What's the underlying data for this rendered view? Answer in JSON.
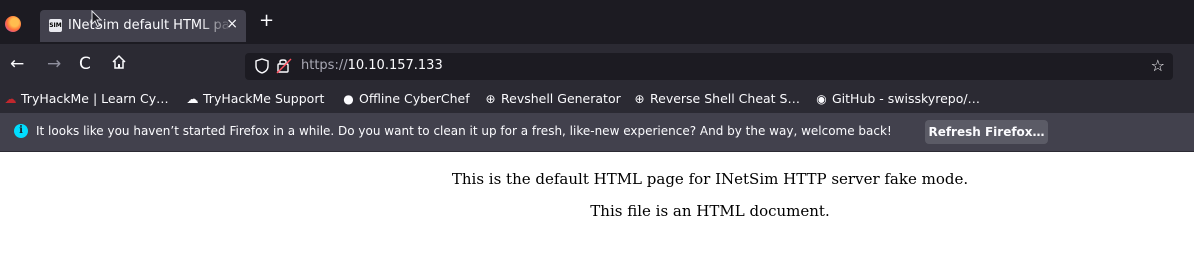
{
  "tab": {
    "favicon_text": "SIM",
    "title": "INetSim default HTML page",
    "close": "×",
    "new_tab": "+"
  },
  "nav": {
    "back": "←",
    "forward": "→",
    "reload": "C",
    "home": "⌂",
    "url_scheme": "https://",
    "url_host": "10.10.157.133",
    "star": "☆"
  },
  "bookmarks": [
    {
      "label": "TryHackMe | Learn Cy…",
      "icon": "tryhackme-icon"
    },
    {
      "label": "TryHackMe Support",
      "icon": "support-icon"
    },
    {
      "label": "Offline CyberChef",
      "icon": "chef-icon"
    },
    {
      "label": "Revshell Generator",
      "icon": "globe-icon"
    },
    {
      "label": "Reverse Shell Cheat S…",
      "icon": "globe-icon"
    },
    {
      "label": "GitHub - swisskyrepo/…",
      "icon": "github-icon"
    }
  ],
  "notification": {
    "text": "It looks like you haven’t started Firefox in a while. Do you want to clean it up for a fresh, like-new experience? And by the way, welcome back!",
    "button": "Refresh Firefox…"
  },
  "page": {
    "line1": "This is the default HTML page for INetSim HTTP server fake mode.",
    "line2": "This file is an HTML document."
  },
  "colors": {
    "tabstrip": "#1c1b22",
    "toolbar": "#2b2a33",
    "notification": "#42414d",
    "info_accent": "#00ddff"
  }
}
